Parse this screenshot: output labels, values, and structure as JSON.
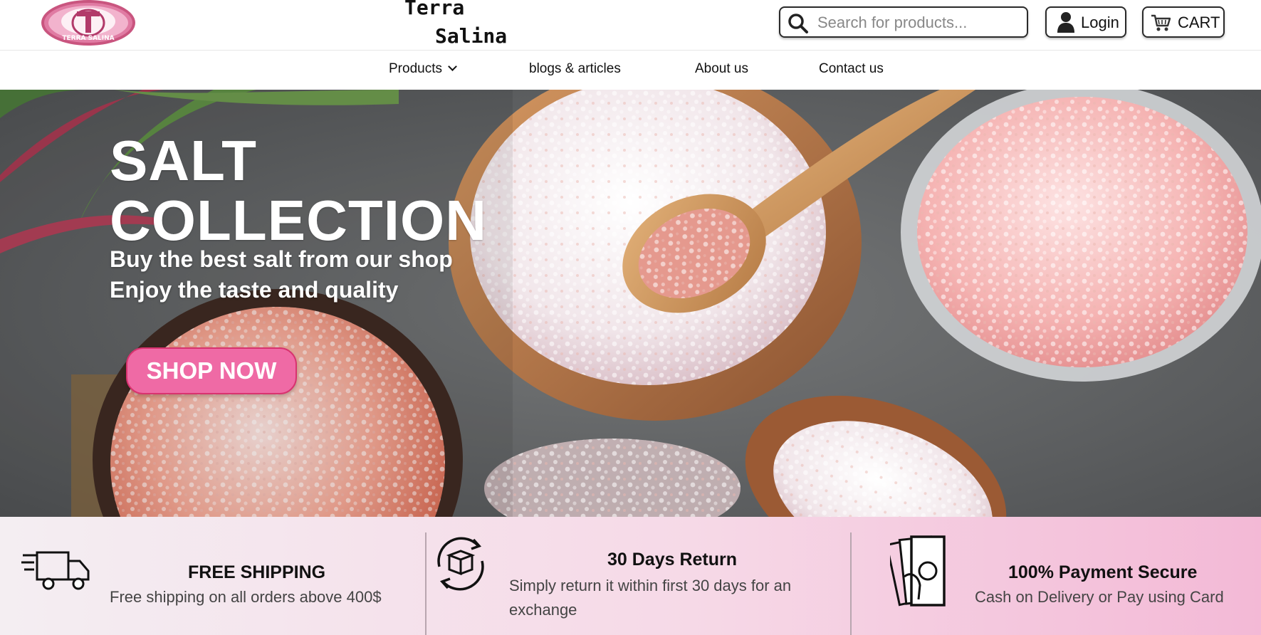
{
  "header": {
    "brand_line1": "Terra",
    "brand_line2": "Salina",
    "logo_text": "TERRA SALINA",
    "search_placeholder": "Search for products...",
    "login_label": "Login",
    "cart_label": "CART"
  },
  "nav": {
    "items": [
      {
        "label": "Products",
        "has_dropdown": true
      },
      {
        "label": "blogs & articles"
      },
      {
        "label": "About us"
      },
      {
        "label": "Contact us"
      }
    ]
  },
  "hero": {
    "title_line1": "SALT",
    "title_line2": "COLLECTION",
    "subtitle_line1": "Buy the best salt from our shop",
    "subtitle_line2": "Enjoy the taste and quality",
    "cta_label": "SHOP NOW"
  },
  "features": [
    {
      "icon": "truck-icon",
      "title": "FREE SHIPPING",
      "desc": "Free shipping on all orders above 400$"
    },
    {
      "icon": "box-return-icon",
      "title": "30 Days Return",
      "desc": "Simply return it within first 30 days for an exchange"
    },
    {
      "icon": "cash-payment-icon",
      "title": "100% Payment Secure",
      "desc": "Cash on Delivery or Pay using Card"
    }
  ],
  "colors": {
    "accent_pink": "#ef6aa5",
    "accent_pink_border": "#d8336f",
    "text_dark": "#111111"
  }
}
